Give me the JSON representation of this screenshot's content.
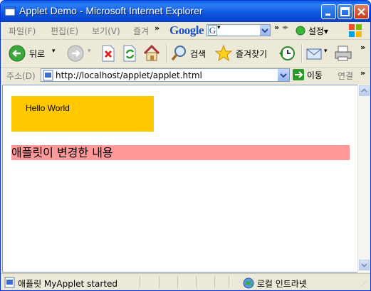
{
  "window": {
    "title": "Applet Demo - Microsoft Internet Explorer"
  },
  "menu": {
    "items": [
      {
        "label": "파일(F)"
      },
      {
        "label": "편집(E)"
      },
      {
        "label": "보기(V)"
      },
      {
        "label": "즐겨"
      }
    ]
  },
  "google_toolbar": {
    "logo": "Google",
    "search_value": "",
    "settings_label": "설정"
  },
  "toolbar": {
    "back_label": "뒤로",
    "search_label": "검색",
    "favorites_label": "즐겨찾기"
  },
  "address": {
    "label": "주소(D)",
    "url": "http://localhost/applet/applet.html",
    "go_label": "이동",
    "links_label": "연결"
  },
  "content": {
    "applet_text": "Hello World",
    "applet_color": "#ffc800",
    "changed_text": "애플릿이 변경한 내용",
    "changed_bg": "#ff9999"
  },
  "status": {
    "text": "애플릿 MyApplet started",
    "zone": "로컬 인트라넷"
  },
  "colors": {
    "titlebar": "#0a55e0",
    "chrome": "#ece9d8"
  }
}
